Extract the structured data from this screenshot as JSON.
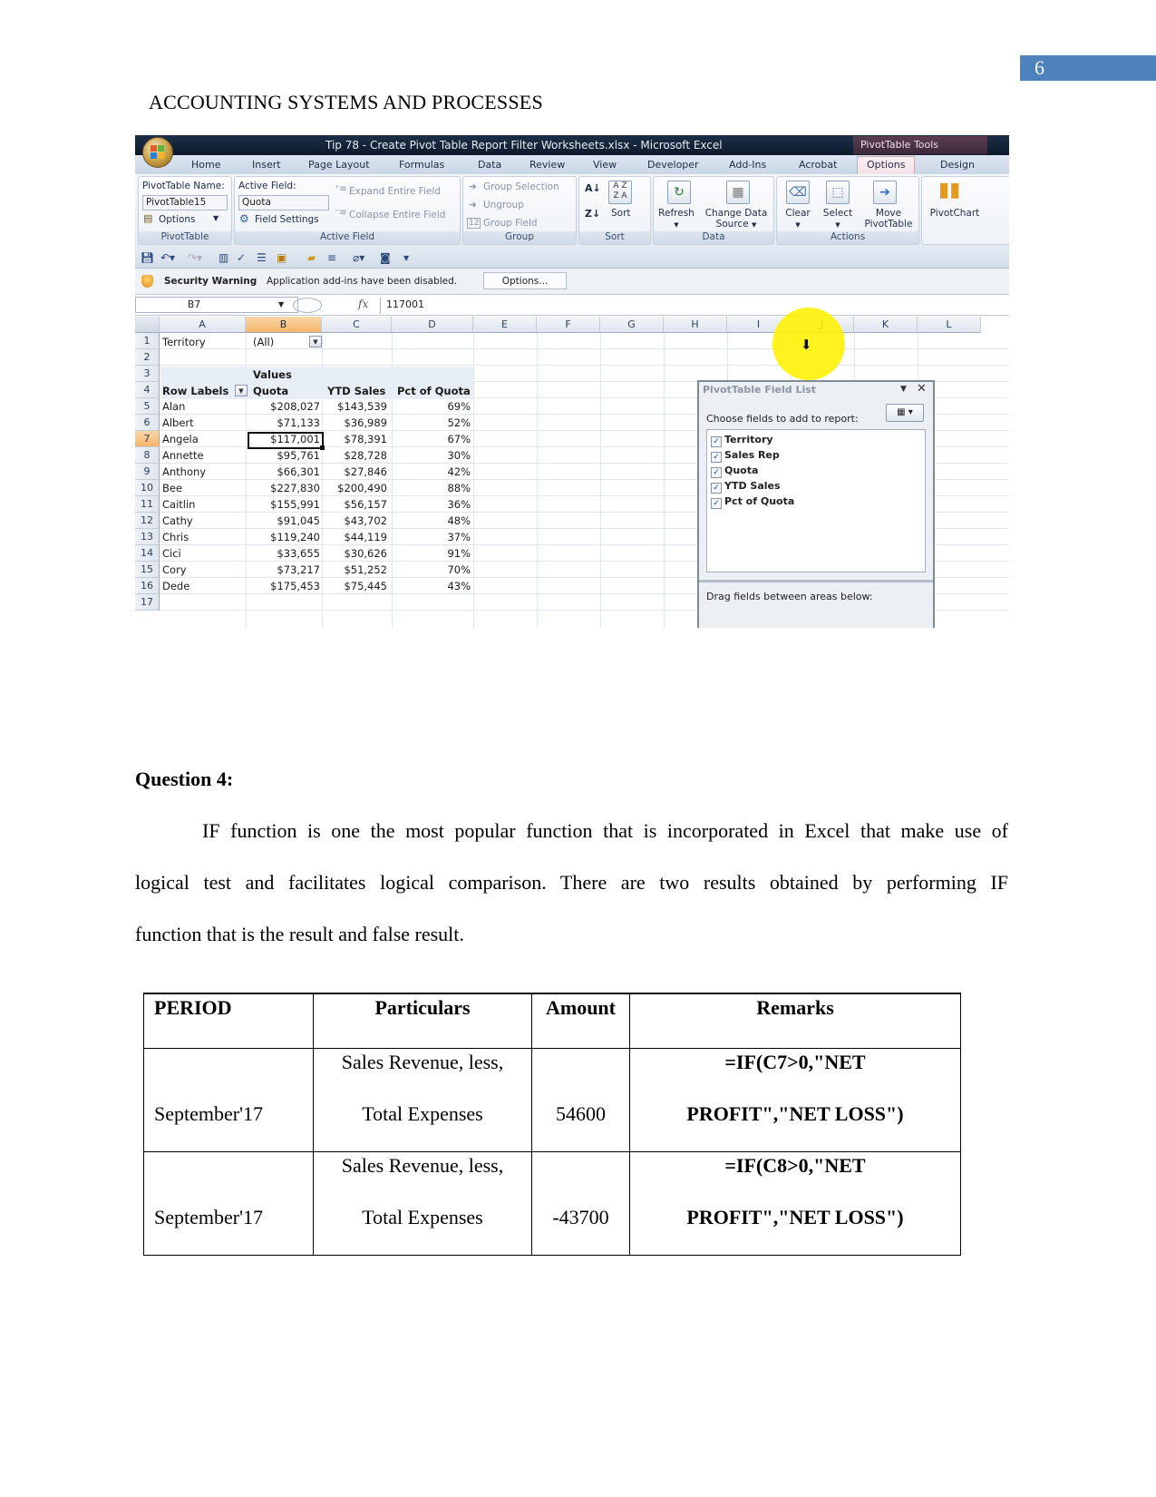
{
  "page": {
    "number": "6",
    "running_head": "ACCOUNTING SYSTEMS AND PROCESSES"
  },
  "excel": {
    "window_title": "Tip 78 - Create Pivot Table Report Filter Worksheets.xlsx - Microsoft Excel",
    "contextual_tools": "PivotTable Tools",
    "tabs": [
      "Home",
      "Insert",
      "Page Layout",
      "Formulas",
      "Data",
      "Review",
      "View",
      "Developer",
      "Add-Ins",
      "Acrobat",
      "Options",
      "Design"
    ],
    "active_tab": "Options",
    "ribbon": {
      "pivottable": {
        "name_label": "PivotTable Name:",
        "name_value": "PivotTable15",
        "options_label": "Options",
        "group_label": "PivotTable"
      },
      "active_field": {
        "field_label": "Active Field:",
        "field_value": "Quota",
        "field_settings": "Field Settings",
        "expand": "Expand Entire Field",
        "collapse": "Collapse Entire Field",
        "group_label": "Active Field"
      },
      "group": {
        "group_selection": "Group Selection",
        "ungroup": "Ungroup",
        "group_field": "Group Field",
        "group_label": "Group"
      },
      "sort": {
        "sort_label": "Sort",
        "group_label": "Sort"
      },
      "data": {
        "refresh": "Refresh",
        "change_source_1": "Change Data",
        "change_source_2": "Source",
        "group_label": "Data"
      },
      "actions": {
        "clear": "Clear",
        "select": "Select",
        "move_1": "Move",
        "move_2": "PivotTable",
        "group_label": "Actions"
      },
      "pivotchart": "PivotChart"
    },
    "security_bar": {
      "title": "Security Warning",
      "message": "Application add-ins have been disabled.",
      "options_button": "Options..."
    },
    "formula_bar": {
      "name_box": "B7",
      "fx": "fx",
      "value": "117001"
    },
    "columns": [
      "A",
      "B",
      "C",
      "D",
      "E",
      "F",
      "G",
      "H",
      "I",
      "J",
      "K",
      "L"
    ],
    "selected_column": "B",
    "selected_row": "7",
    "sheet": {
      "filter_label": "Territory",
      "filter_value": "(All)",
      "values_label": "Values",
      "headers": [
        "Row Labels",
        "Quota",
        "YTD Sales",
        "Pct of Quota"
      ],
      "rows": [
        {
          "row": "5",
          "name": "Alan",
          "quota": "$208,027",
          "ytd": "$143,539",
          "pct": "69%"
        },
        {
          "row": "6",
          "name": "Albert",
          "quota": "$71,133",
          "ytd": "$36,989",
          "pct": "52%"
        },
        {
          "row": "7",
          "name": "Angela",
          "quota": "$117,001",
          "ytd": "$78,391",
          "pct": "67%"
        },
        {
          "row": "8",
          "name": "Annette",
          "quota": "$95,761",
          "ytd": "$28,728",
          "pct": "30%"
        },
        {
          "row": "9",
          "name": "Anthony",
          "quota": "$66,301",
          "ytd": "$27,846",
          "pct": "42%"
        },
        {
          "row": "10",
          "name": "Bee",
          "quota": "$227,830",
          "ytd": "$200,490",
          "pct": "88%"
        },
        {
          "row": "11",
          "name": "Caitlin",
          "quota": "$155,991",
          "ytd": "$56,157",
          "pct": "36%"
        },
        {
          "row": "12",
          "name": "Cathy",
          "quota": "$91,045",
          "ytd": "$43,702",
          "pct": "48%"
        },
        {
          "row": "13",
          "name": "Chris",
          "quota": "$119,240",
          "ytd": "$44,119",
          "pct": "37%"
        },
        {
          "row": "14",
          "name": "Cici",
          "quota": "$33,655",
          "ytd": "$30,626",
          "pct": "91%"
        },
        {
          "row": "15",
          "name": "Cory",
          "quota": "$73,217",
          "ytd": "$51,252",
          "pct": "70%"
        },
        {
          "row": "16",
          "name": "Dede",
          "quota": "$175,453",
          "ytd": "$75,445",
          "pct": "43%"
        }
      ]
    },
    "field_list": {
      "title": "PivotTable Field List",
      "choose_label": "Choose fields to add to report:",
      "fields": [
        {
          "label": "Territory",
          "checked": true
        },
        {
          "label": "Sales Rep",
          "checked": true
        },
        {
          "label": "Quota",
          "checked": true
        },
        {
          "label": "YTD Sales",
          "checked": true
        },
        {
          "label": "Pct of Quota",
          "checked": true
        }
      ],
      "drag_label": "Drag fields between areas below:"
    }
  },
  "question": {
    "heading": "Question 4:",
    "paragraph_lines": [
      "IF function is one the most popular function that is incorporated in Excel that make use of",
      "logical test and facilitates logical comparison. There are two results obtained by performing IF",
      "function that is the result and false result."
    ]
  },
  "if_table": {
    "headers": [
      "PERIOD",
      "Particulars",
      "Amount",
      "Remarks"
    ],
    "rows": [
      {
        "period": "September'17",
        "particulars_1": "Sales Revenue, less,",
        "particulars_2": "Total Expenses",
        "amount": "54600",
        "remarks_1": "=IF(C7>0,\"NET",
        "remarks_2": "PROFIT\",\"NET LOSS\")"
      },
      {
        "period": "September'17",
        "particulars_1": "Sales Revenue, less,",
        "particulars_2": "Total Expenses",
        "amount": "-43700",
        "remarks_1": "=IF(C8>0,\"NET",
        "remarks_2": "PROFIT\",\"NET LOSS\")"
      }
    ]
  }
}
